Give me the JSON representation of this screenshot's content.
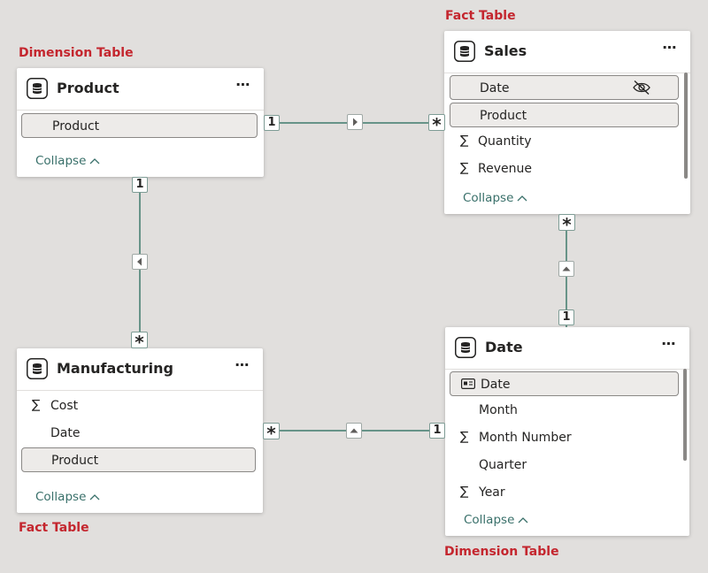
{
  "labels": {
    "product_role": "Dimension Table",
    "sales_role": "Fact Table",
    "manufacturing_role": "Fact Table",
    "date_role": "Dimension Table"
  },
  "tables": {
    "product": {
      "title": "Product",
      "more": "⋯",
      "fields": [
        {
          "name": "Product"
        }
      ],
      "collapse": "Collapse"
    },
    "sales": {
      "title": "Sales",
      "more": "⋯",
      "fields": [
        {
          "name": "Date",
          "hidden": true
        },
        {
          "name": "Product"
        },
        {
          "name": "Quantity",
          "sigma": "∑"
        },
        {
          "name": "Revenue",
          "sigma": "∑"
        }
      ],
      "collapse": "Collapse"
    },
    "manufacturing": {
      "title": "Manufacturing",
      "more": "⋯",
      "fields": [
        {
          "name": "Cost",
          "sigma": "∑"
        },
        {
          "name": "Date"
        },
        {
          "name": "Product"
        }
      ],
      "collapse": "Collapse"
    },
    "date": {
      "title": "Date",
      "more": "⋯",
      "fields": [
        {
          "name": "Date",
          "icon": "id-card-icon"
        },
        {
          "name": "Month"
        },
        {
          "name": "Month Number",
          "sigma": "∑"
        },
        {
          "name": "Quarter"
        },
        {
          "name": "Year",
          "sigma": "∑"
        }
      ],
      "collapse": "Collapse"
    }
  },
  "relationships": {
    "product_sales": {
      "one": "1",
      "many": "*"
    },
    "product_manufacturing": {
      "one": "1",
      "many": "*"
    },
    "date_sales": {
      "one": "1",
      "many": "*"
    },
    "date_manufacturing": {
      "one": "1",
      "many": "*"
    }
  },
  "colors": {
    "line": "#3f7a6c",
    "role_label": "#c4262e",
    "collapse": "#39706a"
  },
  "icons": {
    "table": "database-icon",
    "hidden": "eye-off-icon",
    "key": "id-card-icon",
    "more": "more-icon",
    "collapse": "chevron-up-icon"
  }
}
